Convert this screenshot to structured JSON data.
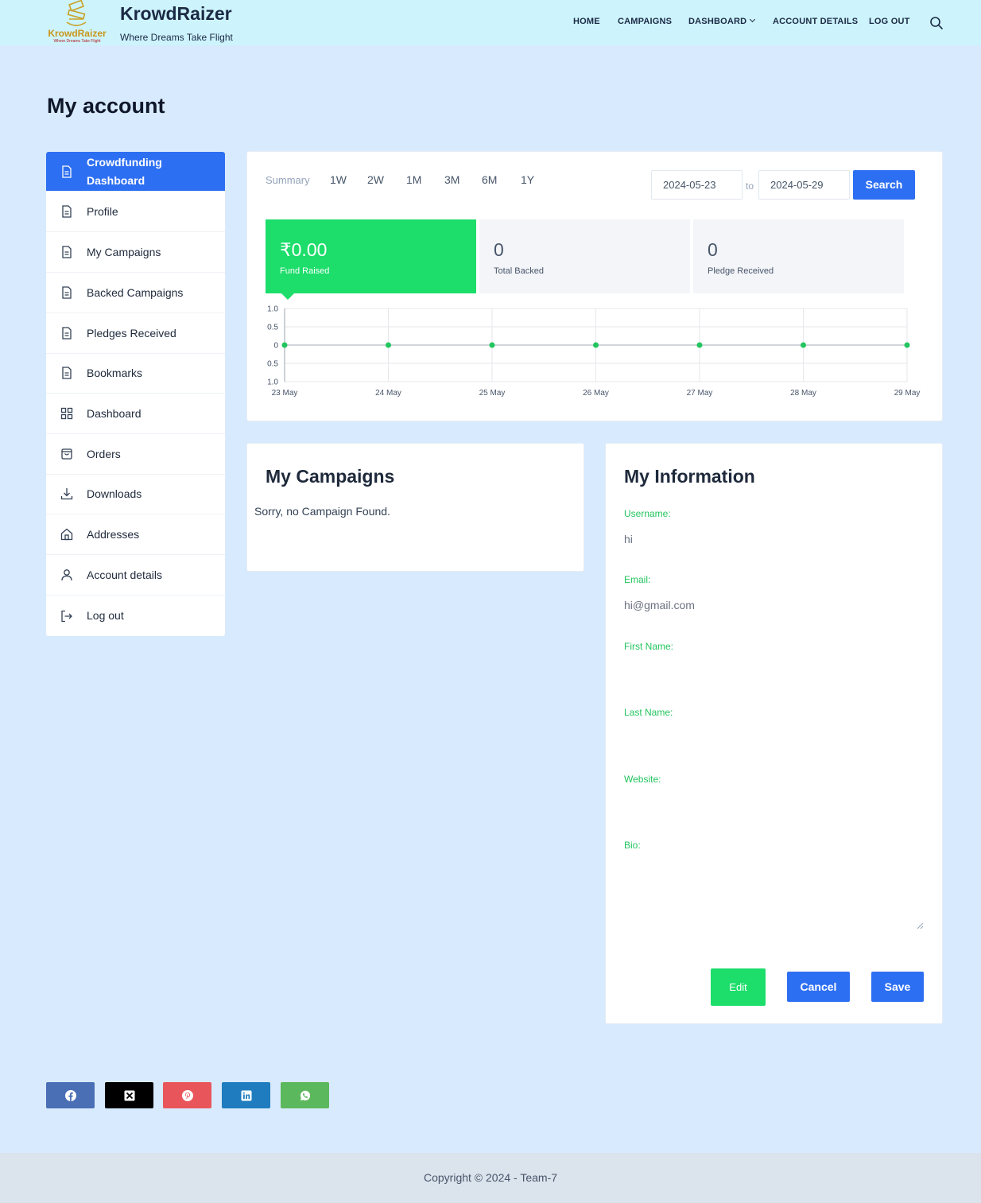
{
  "header": {
    "brand_title": "KrowdRaizer",
    "brand_tagline": "Where Dreams Take Flight",
    "logo_text": "KrowdRaizer",
    "logo_subtext": "Where Dreams Take Flight",
    "nav": [
      {
        "label": "HOME"
      },
      {
        "label": "CAMPAIGNS"
      },
      {
        "label": "DASHBOARD"
      },
      {
        "label": "ACCOUNT DETAILS"
      },
      {
        "label": "LOG OUT"
      }
    ]
  },
  "page": {
    "title": "My account"
  },
  "sidebar": {
    "items": [
      {
        "label": "Crowdfunding Dashboard",
        "icon": "document-icon",
        "active": true
      },
      {
        "label": "Profile",
        "icon": "document-icon"
      },
      {
        "label": "My Campaigns",
        "icon": "document-icon"
      },
      {
        "label": "Backed Campaigns",
        "icon": "document-icon"
      },
      {
        "label": "Pledges Received",
        "icon": "document-icon"
      },
      {
        "label": "Bookmarks",
        "icon": "document-icon"
      },
      {
        "label": "Dashboard",
        "icon": "grid-icon"
      },
      {
        "label": "Orders",
        "icon": "bag-icon"
      },
      {
        "label": "Downloads",
        "icon": "download-icon"
      },
      {
        "label": "Addresses",
        "icon": "home-icon"
      },
      {
        "label": "Account details",
        "icon": "user-icon"
      },
      {
        "label": "Log out",
        "icon": "logout-icon"
      }
    ]
  },
  "dashboard": {
    "periods": [
      "Summary",
      "1W",
      "2W",
      "1M",
      "3M",
      "6M",
      "1Y"
    ],
    "date_from": "2024-05-23",
    "to_label": "to",
    "date_to": "2024-05-29",
    "search_label": "Search",
    "stats": [
      {
        "value": "₹0.00",
        "label": "Fund Raised"
      },
      {
        "value": "0",
        "label": "Total Backed"
      },
      {
        "value": "0",
        "label": "Pledge Received"
      }
    ]
  },
  "chart_data": {
    "type": "line",
    "x": [
      "23 May",
      "24 May",
      "25 May",
      "26 May",
      "27 May",
      "28 May",
      "29 May"
    ],
    "series": [
      {
        "values": [
          0,
          0,
          0,
          0,
          0,
          0,
          0
        ]
      }
    ],
    "y_ticks": [
      "1.0",
      "0.5",
      "0",
      "0.5",
      "1.0"
    ],
    "ylim": [
      -1,
      1
    ],
    "grid": true
  },
  "campaigns": {
    "title": "My Campaigns",
    "empty_message": "Sorry, no Campaign Found."
  },
  "info": {
    "title": "My Information",
    "username_label": "Username:",
    "username_value": "hi",
    "email_label": "Email:",
    "email_value": "hi@gmail.com",
    "first_name_label": "First Name:",
    "last_name_label": "Last Name:",
    "website_label": "Website:",
    "bio_label": "Bio:",
    "edit_label": "Edit",
    "cancel_label": "Cancel",
    "save_label": "Save"
  },
  "share": [
    {
      "icon": "facebook-icon",
      "color": "#4a6fb5"
    },
    {
      "icon": "x-icon",
      "color": "#000000"
    },
    {
      "icon": "pinterest-icon",
      "color": "#e8565b"
    },
    {
      "icon": "linkedin-icon",
      "color": "#1f7dbf"
    },
    {
      "icon": "whatsapp-icon",
      "color": "#5cb85c"
    }
  ],
  "footer": {
    "copyright": "Copyright © 2024 - Team-7"
  },
  "colors": {
    "accent": "#2d6ff2",
    "success": "#1ddd6b",
    "header_bg": "#cdf3fd",
    "page_bg": "#d8eafd"
  }
}
